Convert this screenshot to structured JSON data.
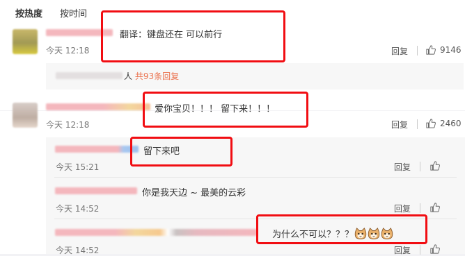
{
  "sort_tabs": [
    "按热度",
    "按时间"
  ],
  "comments": [
    {
      "text": "翻译：键盘还在 可以前行",
      "time": "今天 12:18",
      "reply": "回复",
      "likes": "9146"
    },
    {
      "text": "爱你宝贝！！！ 留下来！！！",
      "time": "今天 12:18",
      "reply": "回复",
      "likes": "2460"
    }
  ],
  "more_replies": {
    "suffix": "人",
    "link": "共93条回复"
  },
  "replies": [
    {
      "text": "留下来吧",
      "time": "今天 15:21",
      "reply": "回复"
    },
    {
      "text": "你是我天边 ~ 最美的云彩",
      "time": "今天 14:52",
      "reply": "回复"
    },
    {
      "text": "为什么不可以？？？",
      "time": "今天 14:52",
      "reply": "回复",
      "emoji": "cat-face-emoji"
    }
  ],
  "colors": {
    "highlight_border": "#f10d12",
    "link": "#eb7350",
    "background": "#f2f2f5"
  }
}
